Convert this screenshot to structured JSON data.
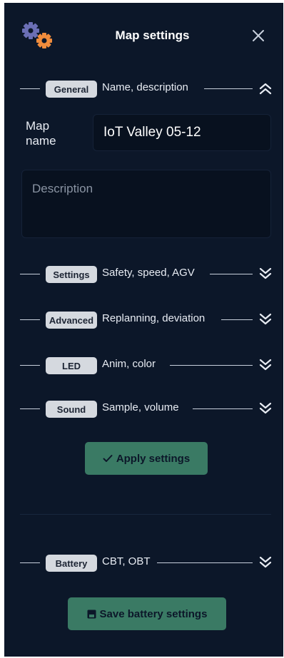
{
  "header": {
    "title": "Map settings"
  },
  "sections": [
    {
      "key": "general",
      "badge": "General",
      "description": "Name, description",
      "expanded": true
    },
    {
      "key": "settings",
      "badge": "Settings",
      "description": "Safety, speed, AGV",
      "expanded": false
    },
    {
      "key": "advanced",
      "badge": "Advanced",
      "description": "Replanning, deviation",
      "expanded": false
    },
    {
      "key": "led",
      "badge": "LED",
      "description": "Anim, color",
      "expanded": false
    },
    {
      "key": "sound",
      "badge": "Sound",
      "description": "Sample, volume",
      "expanded": false
    },
    {
      "key": "battery",
      "badge": "Battery",
      "description": "CBT, OBT",
      "expanded": false
    }
  ],
  "general": {
    "map_name_label": "Map\nname",
    "map_name_value": "IoT Valley 05-12",
    "description_placeholder": "Description"
  },
  "actions": {
    "apply_label": "Apply settings",
    "save_battery_label": "Save battery settings"
  },
  "colors": {
    "panel_bg": "#0c1729",
    "button_bg": "#3a7a64",
    "badge_bg": "#d5d9df",
    "gear_purple": "#6b6fb5",
    "gear_orange": "#f08c3c"
  }
}
